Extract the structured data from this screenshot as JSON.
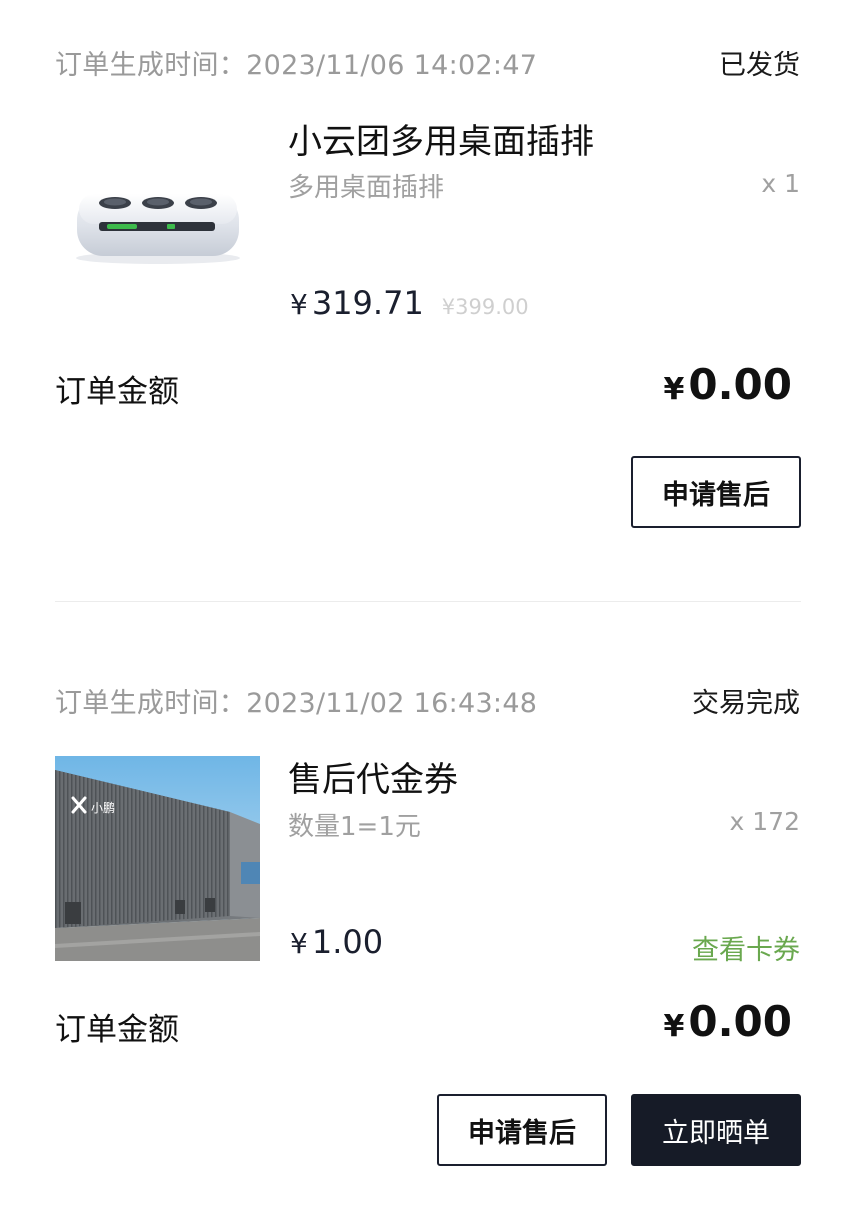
{
  "orders": [
    {
      "time_label": "订单生成时间：",
      "time_value": "2023/11/06 14:02:47",
      "status": "已发货",
      "item": {
        "title": "小云团多用桌面插排",
        "spec": "多用桌面插排",
        "qty": "x 1",
        "price_symbol": "¥",
        "price": "319.71",
        "original_price": "¥399.00",
        "thumb_icon": "power-strip-product-image"
      },
      "amount_label": "订单金额",
      "amount_symbol": "¥",
      "amount_value": "0.00",
      "buttons": [
        "申请售后"
      ]
    },
    {
      "time_label": "订单生成时间：",
      "time_value": "2023/11/02 16:43:48",
      "status": "交易完成",
      "item": {
        "title": "售后代金券",
        "spec": "数量1=1元",
        "qty": "x 172",
        "price_symbol": "¥",
        "price": "1.00",
        "link": "查看卡券",
        "thumb_icon": "xpeng-building-image",
        "thumb_sign": "小鹏"
      },
      "amount_label": "订单金额",
      "amount_symbol": "¥",
      "amount_value": "0.00",
      "buttons": [
        "申请售后",
        "立即晒单"
      ]
    }
  ],
  "colors": {
    "primary_dark": "#161b27",
    "link_green": "#6aa84f",
    "muted_text": "#9a9a9a"
  }
}
